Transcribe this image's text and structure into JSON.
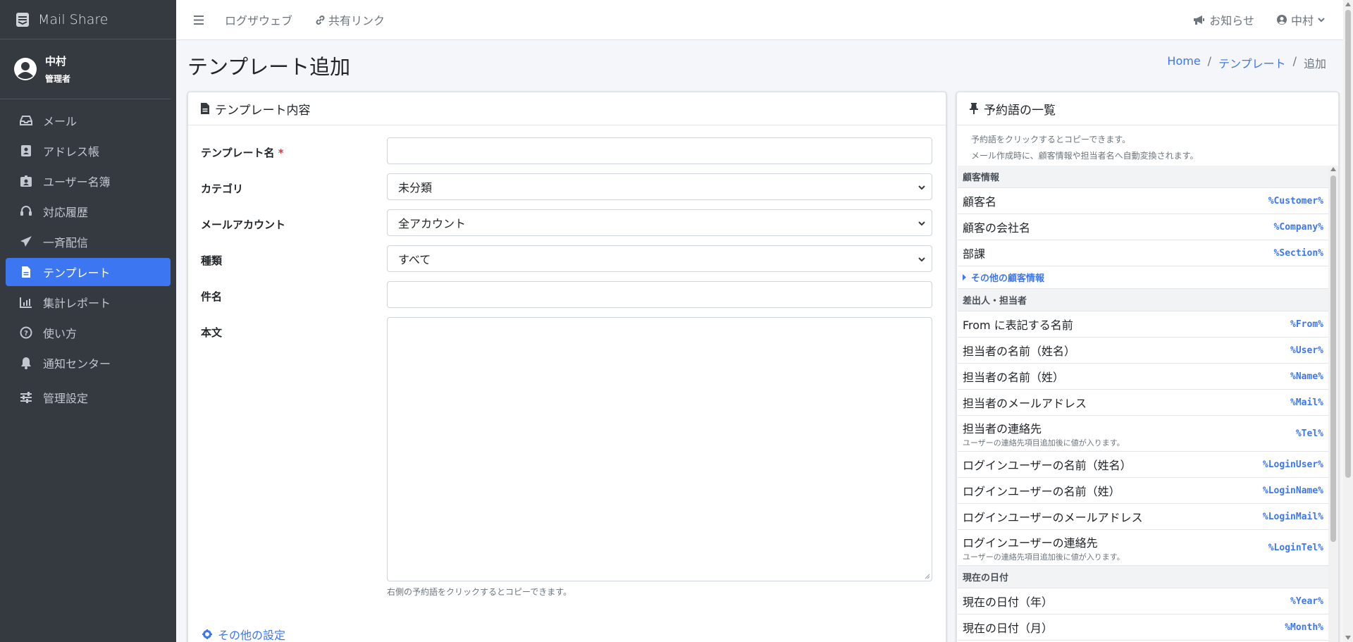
{
  "app": {
    "name": "Mail Share"
  },
  "user": {
    "name": "中村",
    "role": "管理者"
  },
  "sidebar": {
    "items": [
      {
        "label": "メール",
        "icon": "inbox-icon"
      },
      {
        "label": "アドレス帳",
        "icon": "address-book-icon"
      },
      {
        "label": "ユーザー名簿",
        "icon": "id-badge-icon"
      },
      {
        "label": "対応履歴",
        "icon": "headset-icon"
      },
      {
        "label": "一斉配信",
        "icon": "paper-plane-icon"
      },
      {
        "label": "テンプレート",
        "icon": "file-icon",
        "active": true
      },
      {
        "label": "集計レポート",
        "icon": "chart-icon"
      },
      {
        "label": "使い方",
        "icon": "question-icon"
      },
      {
        "label": "通知センター",
        "icon": "bell-icon"
      },
      {
        "label": "管理設定",
        "icon": "sliders-icon"
      }
    ]
  },
  "topbar": {
    "menu_icon": "bars-icon",
    "logzaweb": "ログザウェブ",
    "share_link": "共有リンク",
    "notice": "お知らせ",
    "user": "中村"
  },
  "page": {
    "title": "テンプレート追加",
    "breadcrumb": [
      "Home",
      "テンプレート",
      "追加"
    ]
  },
  "form": {
    "header": "テンプレート内容",
    "name_label": "テンプレート名",
    "required_mark": "*",
    "category_label": "カテゴリ",
    "category_value": "未分類",
    "account_label": "メールアカウント",
    "account_value": "全アカウント",
    "type_label": "種類",
    "type_value": "すべて",
    "subject_label": "件名",
    "body_label": "本文",
    "body_hint": "右側の予約語をクリックするとコピーできます。",
    "other_settings": "その他の設定"
  },
  "reserved": {
    "header": "予約語の一覧",
    "desc1": "予約語をクリックするとコピーできます。",
    "desc2": "メール作成時に、顧客情報や担当者名へ自動変換されます。",
    "group_customer": "顧客情報",
    "customer": [
      {
        "label": "顧客名",
        "key": "%Customer%"
      },
      {
        "label": "顧客の会社名",
        "key": "%Company%"
      },
      {
        "label": "部課",
        "key": "%Section%"
      }
    ],
    "more_customer": "その他の顧客情報",
    "group_sender": "差出人・担当者",
    "sender": [
      {
        "label": "From に表記する名前",
        "key": "%From%"
      },
      {
        "label": "担当者の名前（姓名）",
        "key": "%User%"
      },
      {
        "label": "担当者の名前（姓）",
        "key": "%Name%"
      },
      {
        "label": "担当者のメールアドレス",
        "key": "%Mail%"
      },
      {
        "label": "担当者の連絡先",
        "key": "%Tel%",
        "sub": "ユーザーの連絡先項目追加後に値が入ります。"
      },
      {
        "label": "ログインユーザーの名前（姓名）",
        "key": "%LoginUser%"
      },
      {
        "label": "ログインユーザーの名前（姓）",
        "key": "%LoginName%"
      },
      {
        "label": "ログインユーザーのメールアドレス",
        "key": "%LoginMail%"
      },
      {
        "label": "ログインユーザーの連絡先",
        "key": "%LoginTel%",
        "sub": "ユーザーの連絡先項目追加後に値が入ります。"
      }
    ],
    "group_date": "現在の日付",
    "date": [
      {
        "label": "現在の日付（年）",
        "key": "%Year%"
      },
      {
        "label": "現在の日付（月）",
        "key": "%Month%"
      }
    ]
  }
}
